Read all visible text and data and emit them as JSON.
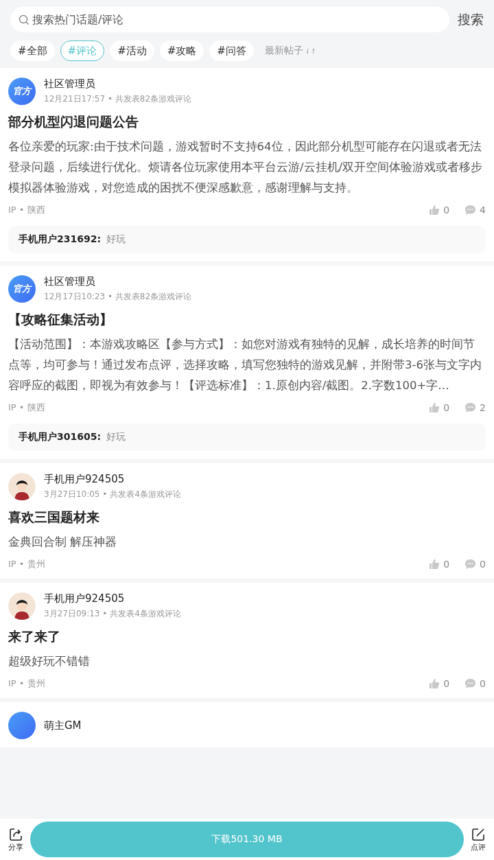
{
  "search": {
    "placeholder": "搜索热门话题/评论",
    "button": "搜索"
  },
  "tags": [
    {
      "label": "#全部",
      "selected": false
    },
    {
      "label": "#评论",
      "selected": true
    },
    {
      "label": "#活动",
      "selected": false
    },
    {
      "label": "#攻略",
      "selected": false
    },
    {
      "label": "#问答",
      "selected": false
    }
  ],
  "sort": {
    "label": "最新帖子",
    "icon": "⇃↾"
  },
  "posts": [
    {
      "avatar": {
        "kind": "official",
        "text": "官方"
      },
      "author": "社区管理员",
      "meta": "12月21日17:57 • 共发表82条游戏评论",
      "title": "部分机型闪退问题公告",
      "body": "各位亲爱的玩家:由于技术问题，游戏暂时不支持64位，因此部分机型可能存在闪退或者无法登录问题，后续进行优化。烦请各位玩家使用本平台云游/云挂机/双开空间体验游戏或者移步模拟器体验游戏，对您造成的困扰不便深感歉意，感谢理解与支持。",
      "ip": "IP • 陕西",
      "likes": "0",
      "comments": "4",
      "reply": {
        "user": "手机用户231692:",
        "text": "好玩"
      }
    },
    {
      "avatar": {
        "kind": "official",
        "text": "官方"
      },
      "author": "社区管理员",
      "meta": "12月17日10:23 • 共发表82条游戏评论",
      "title": "【攻略征集活动】",
      "body": "【活动范围】：本游戏攻略区【参与方式】：如您对游戏有独特的见解，成长培养的时间节点等，均可参与！通过发布点评，选择攻略，填写您独特的游戏见解，并附带3-6张与文字内容呼应的截图，即视为有效参与！【评选标准】：1.原创内容/截图。2.字数100+字…",
      "ip": "IP • 陕西",
      "likes": "0",
      "comments": "2",
      "reply": {
        "user": "手机用户301605:",
        "text": "好玩"
      }
    },
    {
      "avatar": {
        "kind": "user"
      },
      "author": "手机用户924505",
      "meta": "3月27日10:05 • 共发表4条游戏评论",
      "title": "喜欢三国题材来",
      "body": "金典回合制 解压神器",
      "ip": "IP • 贵州",
      "likes": "0",
      "comments": "0"
    },
    {
      "avatar": {
        "kind": "user"
      },
      "author": "手机用户924505",
      "meta": "3月27日09:13 • 共发表4条游戏评论",
      "title": "来了来了",
      "body": "超级好玩不错错",
      "ip": "IP • 贵州",
      "likes": "0",
      "comments": "0"
    },
    {
      "avatar": {
        "kind": "official"
      },
      "author": "萌主GM"
    }
  ],
  "bottom_bar": {
    "share": "分享",
    "download": "下载501.30 MB",
    "review": "点评"
  }
}
